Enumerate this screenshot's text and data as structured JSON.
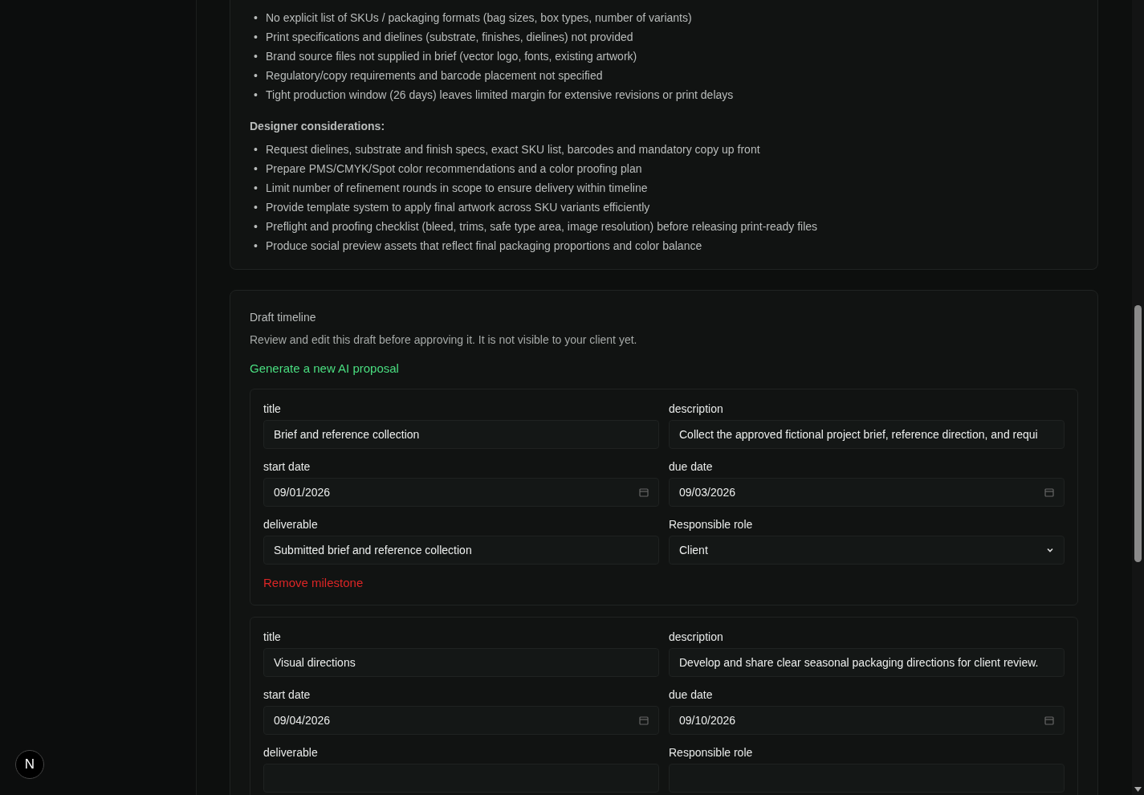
{
  "gaps": {
    "marker": "•",
    "items": [
      "No explicit list of SKUs / packaging formats (bag sizes, box types, number of variants)",
      "Print specifications and dielines (substrate, finishes, dielines) not provided",
      "Brand source files not supplied in brief (vector logo, fonts, existing artwork)",
      "Regulatory/copy requirements and barcode placement not specified",
      "Tight production window (26 days) leaves limited margin for extensive revisions or print delays"
    ]
  },
  "considerations": {
    "heading": "Designer considerations:",
    "marker": "•",
    "items": [
      "Request dielines, substrate and finish specs, exact SKU list, barcodes and mandatory copy up front",
      "Prepare PMS/CMYK/Spot color recommendations and a color proofing plan",
      "Limit number of refinement rounds in scope to ensure delivery within timeline",
      "Provide template system to apply final artwork across SKU variants efficiently",
      "Preflight and proofing checklist (bleed, trims, safe type area, image resolution) before releasing print-ready files",
      "Produce social preview assets that reflect final packaging proportions and color balance"
    ]
  },
  "timeline": {
    "title": "Draft timeline",
    "note": "Review and edit this draft before approving it. It is not visible to your client yet.",
    "generate_link": "Generate a new AI proposal",
    "milestones": [
      {
        "fields": [
          {
            "label": "title",
            "kind": "text",
            "value": "Brief and reference collection"
          },
          {
            "label": "description",
            "kind": "text",
            "value": "Collect the approved fictional project brief, reference direction, and requi"
          },
          {
            "label": "start date",
            "kind": "date",
            "value": "09/01/2026"
          },
          {
            "label": "due date",
            "kind": "date",
            "value": "09/03/2026"
          },
          {
            "label": "deliverable",
            "kind": "text",
            "value": "Submitted brief and reference collection"
          },
          {
            "label": "Responsible role",
            "kind": "select",
            "value": "Client"
          }
        ],
        "remove": "Remove milestone"
      },
      {
        "fields": [
          {
            "label": "title",
            "kind": "text",
            "value": "Visual directions"
          },
          {
            "label": "description",
            "kind": "text",
            "value": "Develop and share clear seasonal packaging directions for client review."
          },
          {
            "label": "start date",
            "kind": "date",
            "value": "09/04/2026"
          },
          {
            "label": "due date",
            "kind": "date",
            "value": "09/10/2026"
          },
          {
            "label": "deliverable",
            "kind": "text"
          },
          {
            "label": "Responsible role",
            "kind": "select"
          }
        ]
      }
    ]
  },
  "badge": {
    "letter": "N"
  }
}
